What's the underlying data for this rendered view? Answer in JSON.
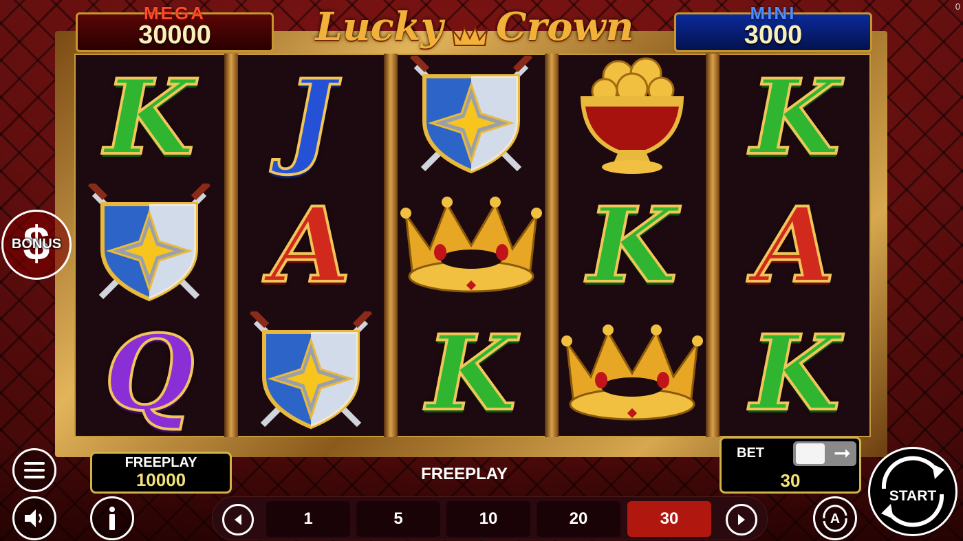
{
  "corner_counter": "0",
  "jackpots": {
    "mega": {
      "label": "MEGA",
      "value": "30000"
    },
    "mini": {
      "label": "MINI",
      "value": "3000"
    }
  },
  "logo": {
    "part1": "Lucky",
    "part2": "Crown"
  },
  "reels": [
    [
      "K",
      "shield",
      "Q"
    ],
    [
      "J",
      "A",
      "shield"
    ],
    [
      "shield",
      "crown",
      "K"
    ],
    [
      "pot-of-gold",
      "K",
      "crown"
    ],
    [
      "K",
      "A",
      "K"
    ]
  ],
  "bonus": {
    "label": "BONUS",
    "symbol": "$"
  },
  "freeplay_panel": {
    "label": "FREEPLAY",
    "value": "10000"
  },
  "status_text": "FREEPLAY",
  "bet_panel": {
    "label": "BET",
    "value": "30"
  },
  "bet_options": [
    "1",
    "5",
    "10",
    "20",
    "30"
  ],
  "selected_bet": "30",
  "start_label": "START",
  "auto_label": "A",
  "colors": {
    "accent_gold": "#d2b24a",
    "selected_bet": "#b0180f",
    "mega": "#ff4b2b",
    "mini": "#4d8dff"
  }
}
